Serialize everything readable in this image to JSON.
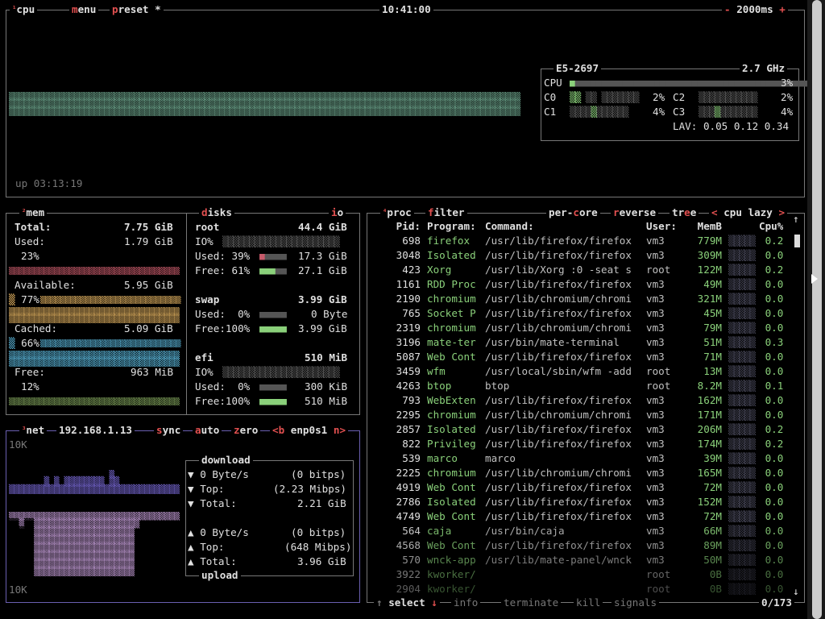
{
  "cpu_box": {
    "tab_cpu": "cpu",
    "tab_menu": "menu",
    "tab_preset": "preset",
    "preset_star": "*",
    "clock": "10:41:00",
    "update_ms": "2000ms",
    "uptime": "up 03:13:19",
    "model": "E5-2697",
    "freq": "2.7 GHz",
    "rows": [
      {
        "label": "CPU",
        "pct": "3%"
      },
      {
        "label": "C0",
        "pct": "2%"
      },
      {
        "label": "C1",
        "pct": "4%"
      },
      {
        "label": "C2",
        "pct": "2%"
      },
      {
        "label": "C3",
        "pct": "4%"
      }
    ],
    "lav_label": "LAV:",
    "lav": "0.05 0.12 0.34"
  },
  "mem": {
    "title": "mem",
    "total_label": "Total:",
    "total": "7.75 GiB",
    "used_label": "Used:",
    "used": "1.79 GiB",
    "used_pct": "23%",
    "avail_label": "Available:",
    "avail": "5.95 GiB",
    "avail_pct": "77%",
    "cached_label": "Cached:",
    "cached": "5.09 GiB",
    "cached_pct": "66%",
    "free_label": "Free:",
    "free": "963 MiB",
    "free_pct": "12%"
  },
  "disks": {
    "title": "disks",
    "io": "io",
    "items": [
      {
        "name": "root",
        "size": "44.4 GiB",
        "io": "IO%",
        "used_label": "Used: 39%",
        "used": "17.3 GiB",
        "free_label": "Free: 61%",
        "free": "27.1 GiB"
      },
      {
        "name": "swap",
        "size": "3.99 GiB",
        "used_label": "Used:  0%",
        "used": "0 Byte",
        "free_label": "Free:100%",
        "free": "3.99 GiB"
      },
      {
        "name": "efi",
        "size": "510 MiB",
        "io": "IO%",
        "used_label": "Used:  0%",
        "used": "300 KiB",
        "free_label": "Free:100%",
        "free": "510 MiB"
      }
    ]
  },
  "net": {
    "title": "net",
    "ip": "192.168.1.13",
    "sync": "sync",
    "auto": "auto",
    "zero": "zero",
    "prev": "<b",
    "iface": "enp0s1",
    "next": "n>",
    "scale_top": "10K",
    "scale_bottom": "10K",
    "download_title": "download",
    "upload_title": "upload",
    "dl": [
      {
        "arrow": "▼",
        "label": "0 Byte/s",
        "value": "(0 bitps)"
      },
      {
        "arrow": "▼",
        "label": "Top:",
        "value": "(2.23 Mibps)"
      },
      {
        "arrow": "▼",
        "label": "Total:",
        "value": "2.21 GiB"
      }
    ],
    "ul": [
      {
        "arrow": "▲",
        "label": "0 Byte/s",
        "value": "(0 bitps)"
      },
      {
        "arrow": "▲",
        "label": "Top:",
        "value": "(648 Mibps)"
      },
      {
        "arrow": "▲",
        "label": "Total:",
        "value": "3.96 GiB"
      }
    ]
  },
  "proc": {
    "title": "proc",
    "filter": "filter",
    "per_core": "per-core",
    "reverse": "reverse",
    "tree": "tree",
    "sort_prev": "<",
    "sort": "cpu lazy",
    "sort_next": ">",
    "headers": {
      "pid": "Pid:",
      "program": "Program:",
      "command": "Command:",
      "user": "User:",
      "mem": "MemB",
      "cpu": "Cpu%"
    },
    "rows": [
      {
        "pid": "698",
        "program": "firefox",
        "command": "/usr/lib/firefox/firefox",
        "user": "vm3",
        "mem": "779M",
        "cpu": "0.2"
      },
      {
        "pid": "3048",
        "program": "Isolated",
        "command": "/usr/lib/firefox/firefox",
        "user": "vm3",
        "mem": "309M",
        "cpu": "0.0"
      },
      {
        "pid": "423",
        "program": "Xorg",
        "command": "/usr/lib/Xorg :0 -seat s",
        "user": "root",
        "mem": "122M",
        "cpu": "0.2"
      },
      {
        "pid": "1161",
        "program": "RDD Proc",
        "command": "/usr/lib/firefox/firefox",
        "user": "vm3",
        "mem": "49M",
        "cpu": "0.0"
      },
      {
        "pid": "2190",
        "program": "chromium",
        "command": "/usr/lib/chromium/chromi",
        "user": "vm3",
        "mem": "321M",
        "cpu": "0.0"
      },
      {
        "pid": "765",
        "program": "Socket P",
        "command": "/usr/lib/firefox/firefox",
        "user": "vm3",
        "mem": "45M",
        "cpu": "0.0"
      },
      {
        "pid": "2319",
        "program": "chromium",
        "command": "/usr/lib/chromium/chromi",
        "user": "vm3",
        "mem": "79M",
        "cpu": "0.0"
      },
      {
        "pid": "3196",
        "program": "mate-ter",
        "command": "/usr/bin/mate-terminal",
        "user": "vm3",
        "mem": "51M",
        "cpu": "0.3"
      },
      {
        "pid": "5087",
        "program": "Web Cont",
        "command": "/usr/lib/firefox/firefox",
        "user": "vm3",
        "mem": "71M",
        "cpu": "0.0"
      },
      {
        "pid": "3459",
        "program": "wfm",
        "command": "/usr/local/sbin/wfm -add",
        "user": "root",
        "mem": "13M",
        "cpu": "0.0"
      },
      {
        "pid": "4263",
        "program": "btop",
        "command": "btop",
        "user": "root",
        "mem": "8.2M",
        "cpu": "0.1"
      },
      {
        "pid": "793",
        "program": "WebExten",
        "command": "/usr/lib/firefox/firefox",
        "user": "vm3",
        "mem": "162M",
        "cpu": "0.0"
      },
      {
        "pid": "2295",
        "program": "chromium",
        "command": "/usr/lib/chromium/chromi",
        "user": "vm3",
        "mem": "171M",
        "cpu": "0.0"
      },
      {
        "pid": "2857",
        "program": "Isolated",
        "command": "/usr/lib/firefox/firefox",
        "user": "vm3",
        "mem": "206M",
        "cpu": "0.2"
      },
      {
        "pid": "822",
        "program": "Privileg",
        "command": "/usr/lib/firefox/firefox",
        "user": "vm3",
        "mem": "174M",
        "cpu": "0.2"
      },
      {
        "pid": "539",
        "program": "marco",
        "command": "marco",
        "user": "vm3",
        "mem": "39M",
        "cpu": "0.0"
      },
      {
        "pid": "2225",
        "program": "chromium",
        "command": "/usr/lib/chromium/chromi",
        "user": "vm3",
        "mem": "165M",
        "cpu": "0.0"
      },
      {
        "pid": "4919",
        "program": "Web Cont",
        "command": "/usr/lib/firefox/firefox",
        "user": "vm3",
        "mem": "72M",
        "cpu": "0.0"
      },
      {
        "pid": "2786",
        "program": "Isolated",
        "command": "/usr/lib/firefox/firefox",
        "user": "vm3",
        "mem": "152M",
        "cpu": "0.0"
      },
      {
        "pid": "4749",
        "program": "Web Cont",
        "command": "/usr/lib/firefox/firefox",
        "user": "vm3",
        "mem": "72M",
        "cpu": "0.0"
      },
      {
        "pid": "564",
        "program": "caja",
        "command": "/usr/bin/caja",
        "user": "vm3",
        "mem": "66M",
        "cpu": "0.0"
      },
      {
        "pid": "4568",
        "program": "Web Cont",
        "command": "/usr/lib/firefox/firefox",
        "user": "vm3",
        "mem": "89M",
        "cpu": "0.0"
      },
      {
        "pid": "570",
        "program": "wnck-app",
        "command": "/usr/lib/mate-panel/wnck",
        "user": "vm3",
        "mem": "50M",
        "cpu": "0.0"
      },
      {
        "pid": "3922",
        "program": "kworker/",
        "command": "",
        "user": "root",
        "mem": "0B",
        "cpu": "0.0"
      },
      {
        "pid": "2904",
        "program": "kworker/",
        "command": "",
        "user": "root",
        "mem": "0B",
        "cpu": "0.0"
      }
    ],
    "footer": {
      "select": "select",
      "info": "info",
      "terminate": "terminate",
      "kill": "kill",
      "signals": "signals",
      "count": "0/173"
    }
  },
  "colors": {
    "accent": "#e25050",
    "cpu_graph": "#6fa88f",
    "mem_used": "#c75a6a",
    "mem_avail": "#e0b060",
    "mem_cached": "#59b4d8",
    "mem_free": "#7fa05a",
    "net_dl": "#7a6ad8",
    "net_ul": "#c39cd6"
  }
}
